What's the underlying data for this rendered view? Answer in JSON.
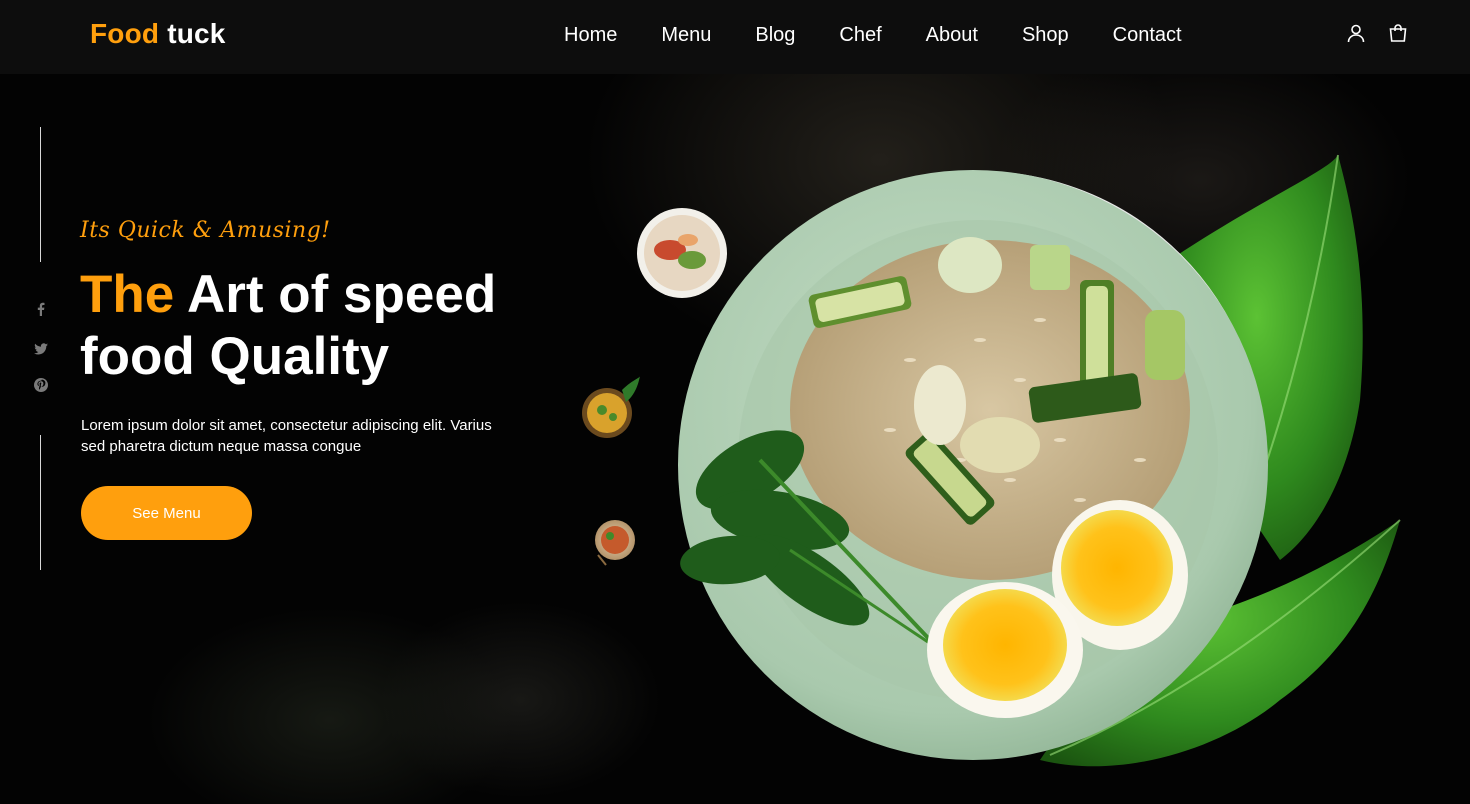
{
  "brand": {
    "name_accent": "Food",
    "name_rest": " tuck"
  },
  "nav": {
    "items": [
      {
        "label": "Home"
      },
      {
        "label": "Menu"
      },
      {
        "label": "Blog"
      },
      {
        "label": "Chef"
      },
      {
        "label": "About"
      },
      {
        "label": "Shop"
      },
      {
        "label": "Contact"
      }
    ]
  },
  "header_icons": [
    "user-icon",
    "shopping-bag-icon"
  ],
  "social_icons": [
    "facebook-icon",
    "twitter-icon",
    "pinterest-icon"
  ],
  "hero": {
    "tagline": "Its Quick & Amusing!",
    "title_accent": "The",
    "title_rest": " Art of speed food Quality",
    "description": "Lorem ipsum dolor sit amet, consectetur adipiscing elit. Varius sed pharetra dictum neque massa congue",
    "cta_label": "See Menu"
  },
  "colors": {
    "accent": "#FF9F0D",
    "header_bg": "#0d0d0d",
    "page_bg": "#000000"
  }
}
